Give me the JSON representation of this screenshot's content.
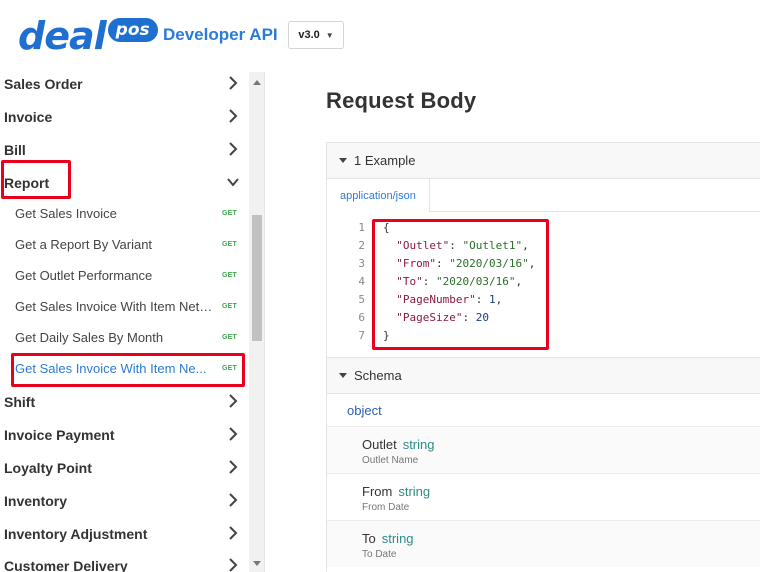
{
  "header": {
    "logo_word": "deal",
    "logo_badge": "pos",
    "title": "Developer API",
    "version": "v3.0"
  },
  "sidebar": {
    "items_top": [
      {
        "label": "Sales Order"
      },
      {
        "label": "Invoice"
      },
      {
        "label": "Bill"
      },
      {
        "label": "Report"
      }
    ],
    "report_children": [
      {
        "label": "Get Sales Invoice",
        "method": "GET"
      },
      {
        "label": "Get a Report By Variant",
        "method": "GET"
      },
      {
        "label": "Get Outlet Performance",
        "method": "GET"
      },
      {
        "label": "Get Sales Invoice With Item Net ...",
        "method": "GET"
      },
      {
        "label": "Get Daily Sales By Month",
        "method": "GET"
      },
      {
        "label": "Get Sales Invoice With Item Ne...",
        "method": "GET"
      }
    ],
    "items_bottom": [
      {
        "label": "Shift"
      },
      {
        "label": "Invoice Payment"
      },
      {
        "label": "Loyalty Point"
      },
      {
        "label": "Inventory"
      },
      {
        "label": "Inventory Adjustment"
      },
      {
        "label": "Customer Delivery"
      }
    ]
  },
  "main": {
    "title": "Request Body",
    "examples_header": "1 Example",
    "content_type_tab": "application/json",
    "code_lines": [
      {
        "no": "1",
        "text": "{"
      },
      {
        "no": "2",
        "key": "\"Outlet\"",
        "value": "\"Outlet1\"",
        "trail": ","
      },
      {
        "no": "3",
        "key": "\"From\"",
        "value": "\"2020/03/16\"",
        "trail": ","
      },
      {
        "no": "4",
        "key": "\"To\"",
        "value": "\"2020/03/16\"",
        "trail": ","
      },
      {
        "no": "5",
        "key": "\"PageNumber\"",
        "value": "1",
        "trail": ","
      },
      {
        "no": "6",
        "key": "\"PageSize\"",
        "value": "20",
        "trail": ""
      },
      {
        "no": "7",
        "text": "}"
      }
    ],
    "schema_header": "Schema",
    "schema_type": "object",
    "properties": [
      {
        "name": "Outlet",
        "type": "string",
        "description": "Outlet Name"
      },
      {
        "name": "From",
        "type": "string",
        "description": "From Date"
      },
      {
        "name": "To",
        "type": "string",
        "description": "To Date"
      }
    ]
  },
  "colors": {
    "brand_blue": "#1f6fd1",
    "link_blue": "#2b7cd6",
    "get_green": "#3aa84b",
    "highlight_red": "#e8001c"
  }
}
